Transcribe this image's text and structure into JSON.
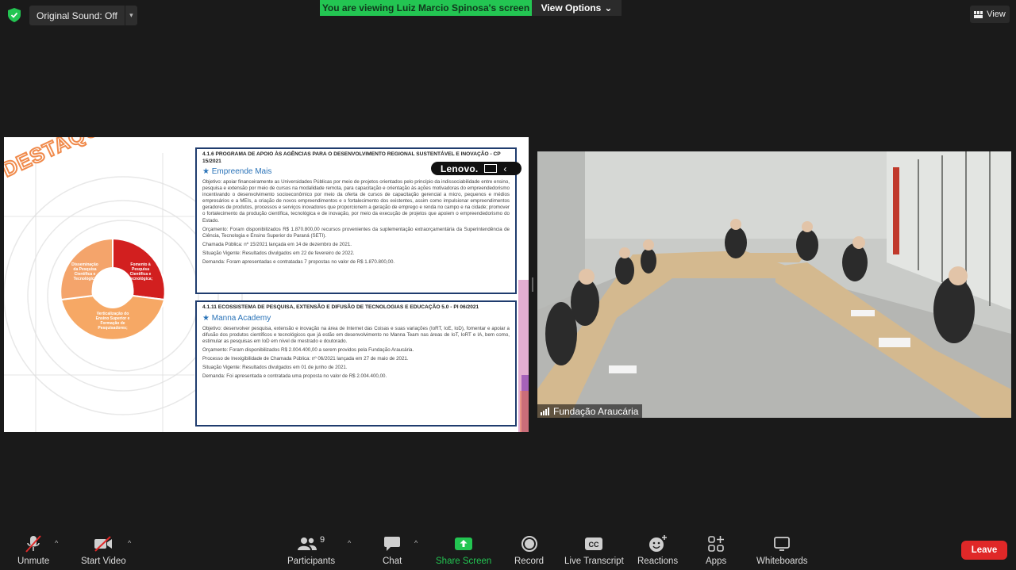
{
  "top_bar": {
    "original_sound": "Original Sound: Off",
    "viewing_banner": "You are viewing Luiz Marcio Spinosa's screen",
    "view_options": "View Options",
    "view_button": "View"
  },
  "slide": {
    "headline": "DESTAQUES",
    "cycle": [
      {
        "label": "Disseminação da Pesquisa Científica e Tecnológica",
        "color": "#f4a46b"
      },
      {
        "label": "Fomento à Pesquisa Científica e Tecnológica;",
        "color": "#d21f1f"
      },
      {
        "label": "Verticalização do Ensino Superior e Formação de Pesquisadores;",
        "color": "#f6a865"
      }
    ],
    "lenovo": "Lenovo.",
    "card1": {
      "title": "4.1.6 PROGRAMA DE APOIO ÀS AGÊNCIAS PARA O DESENVOLVIMENTO REGIONAL SUSTENTÁVEL E INOVAÇÃO - CP 15/2021",
      "subtitle": "★ Empreende Mais",
      "objetivo": "Objetivo: apoiar financeiramente as Universidades Públicas por meio de projetos orientados pelo princípio da indissociabilidade entre ensino, pesquisa e extensão por meio de cursos na modalidade remota, para capacitação e orientação às ações motivadoras do empreendedorismo incentivando o desenvolvimento socioeconômico por meio da oferta de cursos de capacitação gerencial a micro, pequenos e médios empresários e a MEIs, a criação de novos empreendimentos e o fortalecimento dos existentes, assim como impulsionar empreendimentos geradores de produtos, processos e serviços inovadores que proporcionem a geração de emprego e renda no campo e na cidade; promover o fortalecimento da produção científica, tecnológica e de inovação, por meio da execução de projetos que apoiem o empreendedorismo do Estado.",
      "orcamento": "Orçamento: Foram disponibilizados R$ 1.870.800,00 recursos provenientes da suplementação extraorçamentária da Superintendência de Ciência, Tecnologia e Ensino Superior do Paraná (SETI).",
      "chamada": "Chamada Pública: nº 15/2021 lançada em 14 de dezembro de 2021.",
      "situacao": "Situação Vigente: Resultados divulgados em 22 de fevereiro de 2022.",
      "demanda": "Demanda: Foram apresentadas e contratadas 7 propostas no valor de R$ 1.870.800,00."
    },
    "card2": {
      "title": "4.1.11 ECOSSISTEMA DE PESQUISA, EXTENSÃO E DIFUSÃO DE TECNOLOGIAS E EDUCAÇÃO 5.0 - PI 06/2021",
      "subtitle": "★ Manna Academy",
      "objetivo": "Objetivo: desenvolver pesquisa, extensão e inovação na área de Internet das Coisas e suas variações (IoRT, IoE, IoD), fomentar e apoiar a difusão dos produtos científicos e tecnológicos que já estão em desenvolvimento no Manna Team nas áreas de IoT, IoRT e IA, bem como, estimular as pesquisas em IoD em nível de mestrado e doutorado.",
      "orcamento": "Orçamento: Foram disponibilizados R$ 2.004.400,00 a serem providos pela Fundação Araucária.",
      "processo": "Processo de Inexigibilidade de Chamada Pública: nº 06/2021 lançada em 27 de maio de 2021.",
      "situacao": "Situação Vigente: Resultados divulgados em 01 de junho de 2021.",
      "demanda": "Demanda: Foi apresentada e contratada uma proposta no valor de R$ 2.004.400,00."
    }
  },
  "camera": {
    "participant_name": "Fundação Araucária"
  },
  "toolbar": {
    "unmute": "Unmute",
    "start_video": "Start Video",
    "participants": "Participants",
    "participants_count": "9",
    "chat": "Chat",
    "share_screen": "Share Screen",
    "record": "Record",
    "live_transcript": "Live Transcript",
    "reactions": "Reactions",
    "apps": "Apps",
    "whiteboards": "Whiteboards",
    "leave": "Leave"
  }
}
